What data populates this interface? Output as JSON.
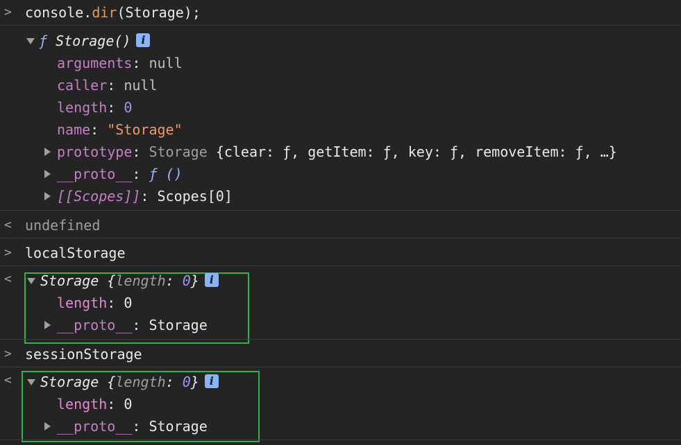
{
  "entries": {
    "cmd1": {
      "prompt": ">",
      "obj": "console",
      "dot": ".",
      "method": "dir",
      "args": "(Storage);"
    },
    "result1": {
      "fn_glyph": "ƒ",
      "title": "Storage()",
      "info": "i",
      "props": [
        {
          "key": "arguments",
          "sep": ": ",
          "value": "null"
        },
        {
          "key": "caller",
          "sep": ": ",
          "value": "null"
        },
        {
          "key": "length",
          "sep": ": ",
          "value": "0"
        },
        {
          "key": "name",
          "sep": ": ",
          "value": "\"Storage\""
        }
      ],
      "prototype": {
        "key": "prototype",
        "sep": ": ",
        "type": "Storage",
        "preview": "{clear: ƒ, getItem: ƒ, key: ƒ, removeItem: ƒ, …}"
      },
      "proto": {
        "key": "__proto__",
        "sep": ": ",
        "value": "ƒ ()"
      },
      "scopes": {
        "key": "[[Scopes]]",
        "sep": ": ",
        "value": "Scopes[0]"
      }
    },
    "return1": {
      "prompt": "<",
      "value": "undefined"
    },
    "cmd2": {
      "prompt": ">",
      "text": "localStorage"
    },
    "result2": {
      "prompt": "<",
      "title": "Storage",
      "preview_open": " {",
      "preview_key": "length",
      "preview_sep": ": ",
      "preview_val": "0",
      "preview_close": "}",
      "info": "i",
      "length_key": "length",
      "length_sep": ": ",
      "length_val": "0",
      "proto_key": "__proto__",
      "proto_sep": ": ",
      "proto_val": "Storage"
    },
    "cmd3": {
      "prompt": ">",
      "text": "sessionStorage"
    },
    "result3": {
      "prompt": "<",
      "title": "Storage",
      "preview_open": " {",
      "preview_key": "length",
      "preview_sep": ": ",
      "preview_val": "0",
      "preview_close": "}",
      "info": "i",
      "length_key": "length",
      "length_sep": ": ",
      "length_val": "0",
      "proto_key": "__proto__",
      "proto_sep": ": ",
      "proto_val": "Storage"
    }
  },
  "colors": {
    "background": "#242424",
    "highlight_box": "#2fb34a",
    "info_badge": "#8ab4f8"
  }
}
